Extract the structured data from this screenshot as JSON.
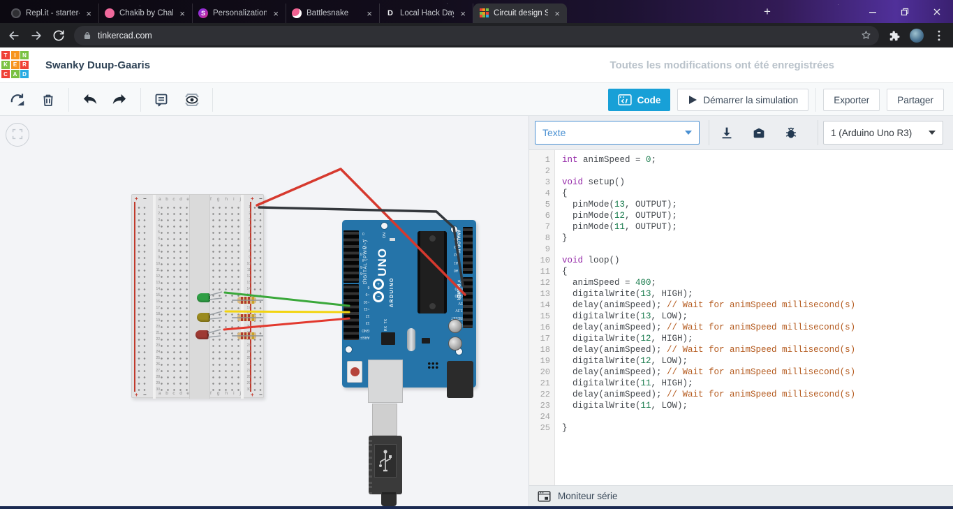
{
  "browser": {
    "tabs": [
      {
        "title": "Repl.it - starter-snake-p",
        "icon": "replit",
        "letter": "",
        "active": false
      },
      {
        "title": "Chakib by Chakib-Boud",
        "icon": "pink",
        "letter": "",
        "active": false
      },
      {
        "title": "Personalization Referen",
        "icon": "purple-s",
        "letter": "S",
        "active": false
      },
      {
        "title": "Battlesnake",
        "icon": "snake",
        "letter": "",
        "active": false
      },
      {
        "title": "Local Hack Day: Build D",
        "icon": "d-letter",
        "letter": "D",
        "active": false
      },
      {
        "title": "Circuit design Swanky D",
        "icon": "tinkercad",
        "letter": "",
        "active": true
      }
    ],
    "close_glyph": "×",
    "new_tab_glyph": "+",
    "url": "tinkercad.com"
  },
  "header": {
    "logo_letters": [
      "T",
      "I",
      "N",
      "K",
      "E",
      "R",
      "C",
      "A",
      "D"
    ],
    "logo_colors": [
      "#ef4136",
      "#f7941e",
      "#7ac143",
      "#7ac143",
      "#f7941e",
      "#ef4136",
      "#ef4136",
      "#7ac143",
      "#29abe2"
    ],
    "title": "Swanky Duup-Gaaris",
    "save_status": "Toutes les modifications ont été enregistrées"
  },
  "toolbar": {
    "accent_color": "#18a0d7",
    "code_label": "Code",
    "simulate_label": "Démarrer la simulation",
    "export_label": "Exporter",
    "share_label": "Partager"
  },
  "code_panel": {
    "mode_select": "Texte",
    "board_select": "1 (Arduino Uno R3)",
    "serial_label": "Moniteur série",
    "lines": [
      [
        {
          "t": "k",
          "s": "int"
        },
        {
          "t": "p",
          "s": " animSpeed = "
        },
        {
          "t": "n",
          "s": "0"
        },
        {
          "t": "p",
          "s": ";"
        }
      ],
      [],
      [
        {
          "t": "k",
          "s": "void"
        },
        {
          "t": "p",
          "s": " setup()"
        }
      ],
      [
        {
          "t": "p",
          "s": "{"
        }
      ],
      [
        {
          "t": "p",
          "s": "  pinMode("
        },
        {
          "t": "n",
          "s": "13"
        },
        {
          "t": "p",
          "s": ", OUTPUT);"
        }
      ],
      [
        {
          "t": "p",
          "s": "  pinMode("
        },
        {
          "t": "n",
          "s": "12"
        },
        {
          "t": "p",
          "s": ", OUTPUT);"
        }
      ],
      [
        {
          "t": "p",
          "s": "  pinMode("
        },
        {
          "t": "n",
          "s": "11"
        },
        {
          "t": "p",
          "s": ", OUTPUT);"
        }
      ],
      [
        {
          "t": "p",
          "s": "}"
        }
      ],
      [],
      [
        {
          "t": "k",
          "s": "void"
        },
        {
          "t": "p",
          "s": " loop()"
        }
      ],
      [
        {
          "t": "p",
          "s": "{"
        }
      ],
      [
        {
          "t": "p",
          "s": "  animSpeed = "
        },
        {
          "t": "n",
          "s": "400"
        },
        {
          "t": "p",
          "s": ";"
        }
      ],
      [
        {
          "t": "p",
          "s": "  digitalWrite("
        },
        {
          "t": "n",
          "s": "13"
        },
        {
          "t": "p",
          "s": ", HIGH);"
        }
      ],
      [
        {
          "t": "p",
          "s": "  delay(animSpeed); "
        },
        {
          "t": "c",
          "s": "// Wait for animSpeed millisecond(s)"
        }
      ],
      [
        {
          "t": "p",
          "s": "  digitalWrite("
        },
        {
          "t": "n",
          "s": "13"
        },
        {
          "t": "p",
          "s": ", LOW);"
        }
      ],
      [
        {
          "t": "p",
          "s": "  delay(animSpeed); "
        },
        {
          "t": "c",
          "s": "// Wait for animSpeed millisecond(s)"
        }
      ],
      [
        {
          "t": "p",
          "s": "  digitalWrite("
        },
        {
          "t": "n",
          "s": "12"
        },
        {
          "t": "p",
          "s": ", HIGH);"
        }
      ],
      [
        {
          "t": "p",
          "s": "  delay(animSpeed); "
        },
        {
          "t": "c",
          "s": "// Wait for animSpeed millisecond(s)"
        }
      ],
      [
        {
          "t": "p",
          "s": "  digitalWrite("
        },
        {
          "t": "n",
          "s": "12"
        },
        {
          "t": "p",
          "s": ", LOW);"
        }
      ],
      [
        {
          "t": "p",
          "s": "  delay(animSpeed); "
        },
        {
          "t": "c",
          "s": "// Wait for animSpeed millisecond(s)"
        }
      ],
      [
        {
          "t": "p",
          "s": "  digitalWrite("
        },
        {
          "t": "n",
          "s": "11"
        },
        {
          "t": "p",
          "s": ", HIGH);"
        }
      ],
      [
        {
          "t": "p",
          "s": "  delay(animSpeed); "
        },
        {
          "t": "c",
          "s": "// Wait for animSpeed millisecond(s)"
        }
      ],
      [
        {
          "t": "p",
          "s": "  digitalWrite("
        },
        {
          "t": "n",
          "s": "11"
        },
        {
          "t": "p",
          "s": ", LOW);"
        }
      ],
      [],
      [
        {
          "t": "p",
          "s": "}"
        }
      ]
    ]
  },
  "canvas": {
    "breadboard": {
      "letters_left": [
        "a",
        "b",
        "c",
        "d",
        "e"
      ],
      "letters_right": [
        "f",
        "g",
        "h",
        "i",
        "j"
      ],
      "row_count": 30,
      "plus": "+",
      "minus": "−"
    },
    "arduino": {
      "board_color": "#2574a9",
      "uno": "UNO",
      "brand": "ARDUINO",
      "digital": "DIGITAL (PWM~)",
      "analog": "ANALOG IN",
      "power": "POWER",
      "on": "ON",
      "tx": "TX",
      "rx": "RX",
      "logo_plus": "+",
      "logo_minus": "−",
      "digital_pins_top": [
        "0",
        "1",
        "2",
        "~3",
        "4",
        "~5",
        "~6",
        "7"
      ],
      "digital_pins_bottom": [
        "8",
        "~9",
        "~10",
        "~11",
        "12",
        "13",
        "GND",
        "AREF"
      ],
      "analog_pins": [
        "A5",
        "A4",
        "A3",
        "A2",
        "A1",
        "A0"
      ],
      "power_pins": [
        "Vin",
        "GND",
        "GND",
        "5V",
        "3.3V",
        "RESET",
        "IOREF"
      ]
    },
    "leds": [
      {
        "name": "green-led",
        "color": "#2f9e44"
      },
      {
        "name": "yellow-led",
        "color": "#9a8a1e"
      },
      {
        "name": "red-led",
        "color": "#9e3a33"
      }
    ],
    "wires": [
      {
        "name": "power-5v-wire",
        "color": "#d6392e"
      },
      {
        "name": "power-gnd-wire",
        "color": "#33373c"
      },
      {
        "name": "pin11-wire",
        "color": "#3aa83a"
      },
      {
        "name": "pin12-wire",
        "color": "#f2d411"
      },
      {
        "name": "pin13-wire",
        "color": "#e2392e"
      }
    ]
  }
}
